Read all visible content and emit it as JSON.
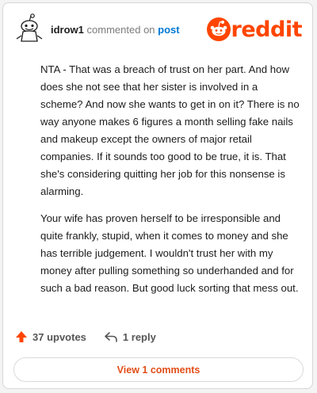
{
  "comment": {
    "username": "idrow1",
    "commented_on_text": "commented on",
    "post_link": "post",
    "paragraphs": [
      "NTA - That was a breach of trust on her part. And how does she not see that her sister is involved in a scheme? And now she wants to get in on it? There is no way anyone makes 6 figures a month selling fake nails and makeup except the owners of major retail companies. If it sounds too good to be true, it is. That she's considering quitting her job for this nonsense is alarming.",
      "Your wife has proven herself to be irresponsible and quite frankly, stupid, when it comes to money and she has terrible judgement. I wouldn't trust her with my money after pulling something so underhanded and for such a bad reason. But good luck sorting that mess out."
    ]
  },
  "brand": {
    "logo_text": "reddit",
    "color": "#ff4500"
  },
  "footer": {
    "upvotes": "37 upvotes",
    "replies": "1 reply",
    "view_comments": "View 1 comments"
  },
  "icons": {
    "upvote": "upvote-arrow-icon",
    "reply": "reply-arrow-icon",
    "avatar": "snoo-avatar-icon"
  }
}
